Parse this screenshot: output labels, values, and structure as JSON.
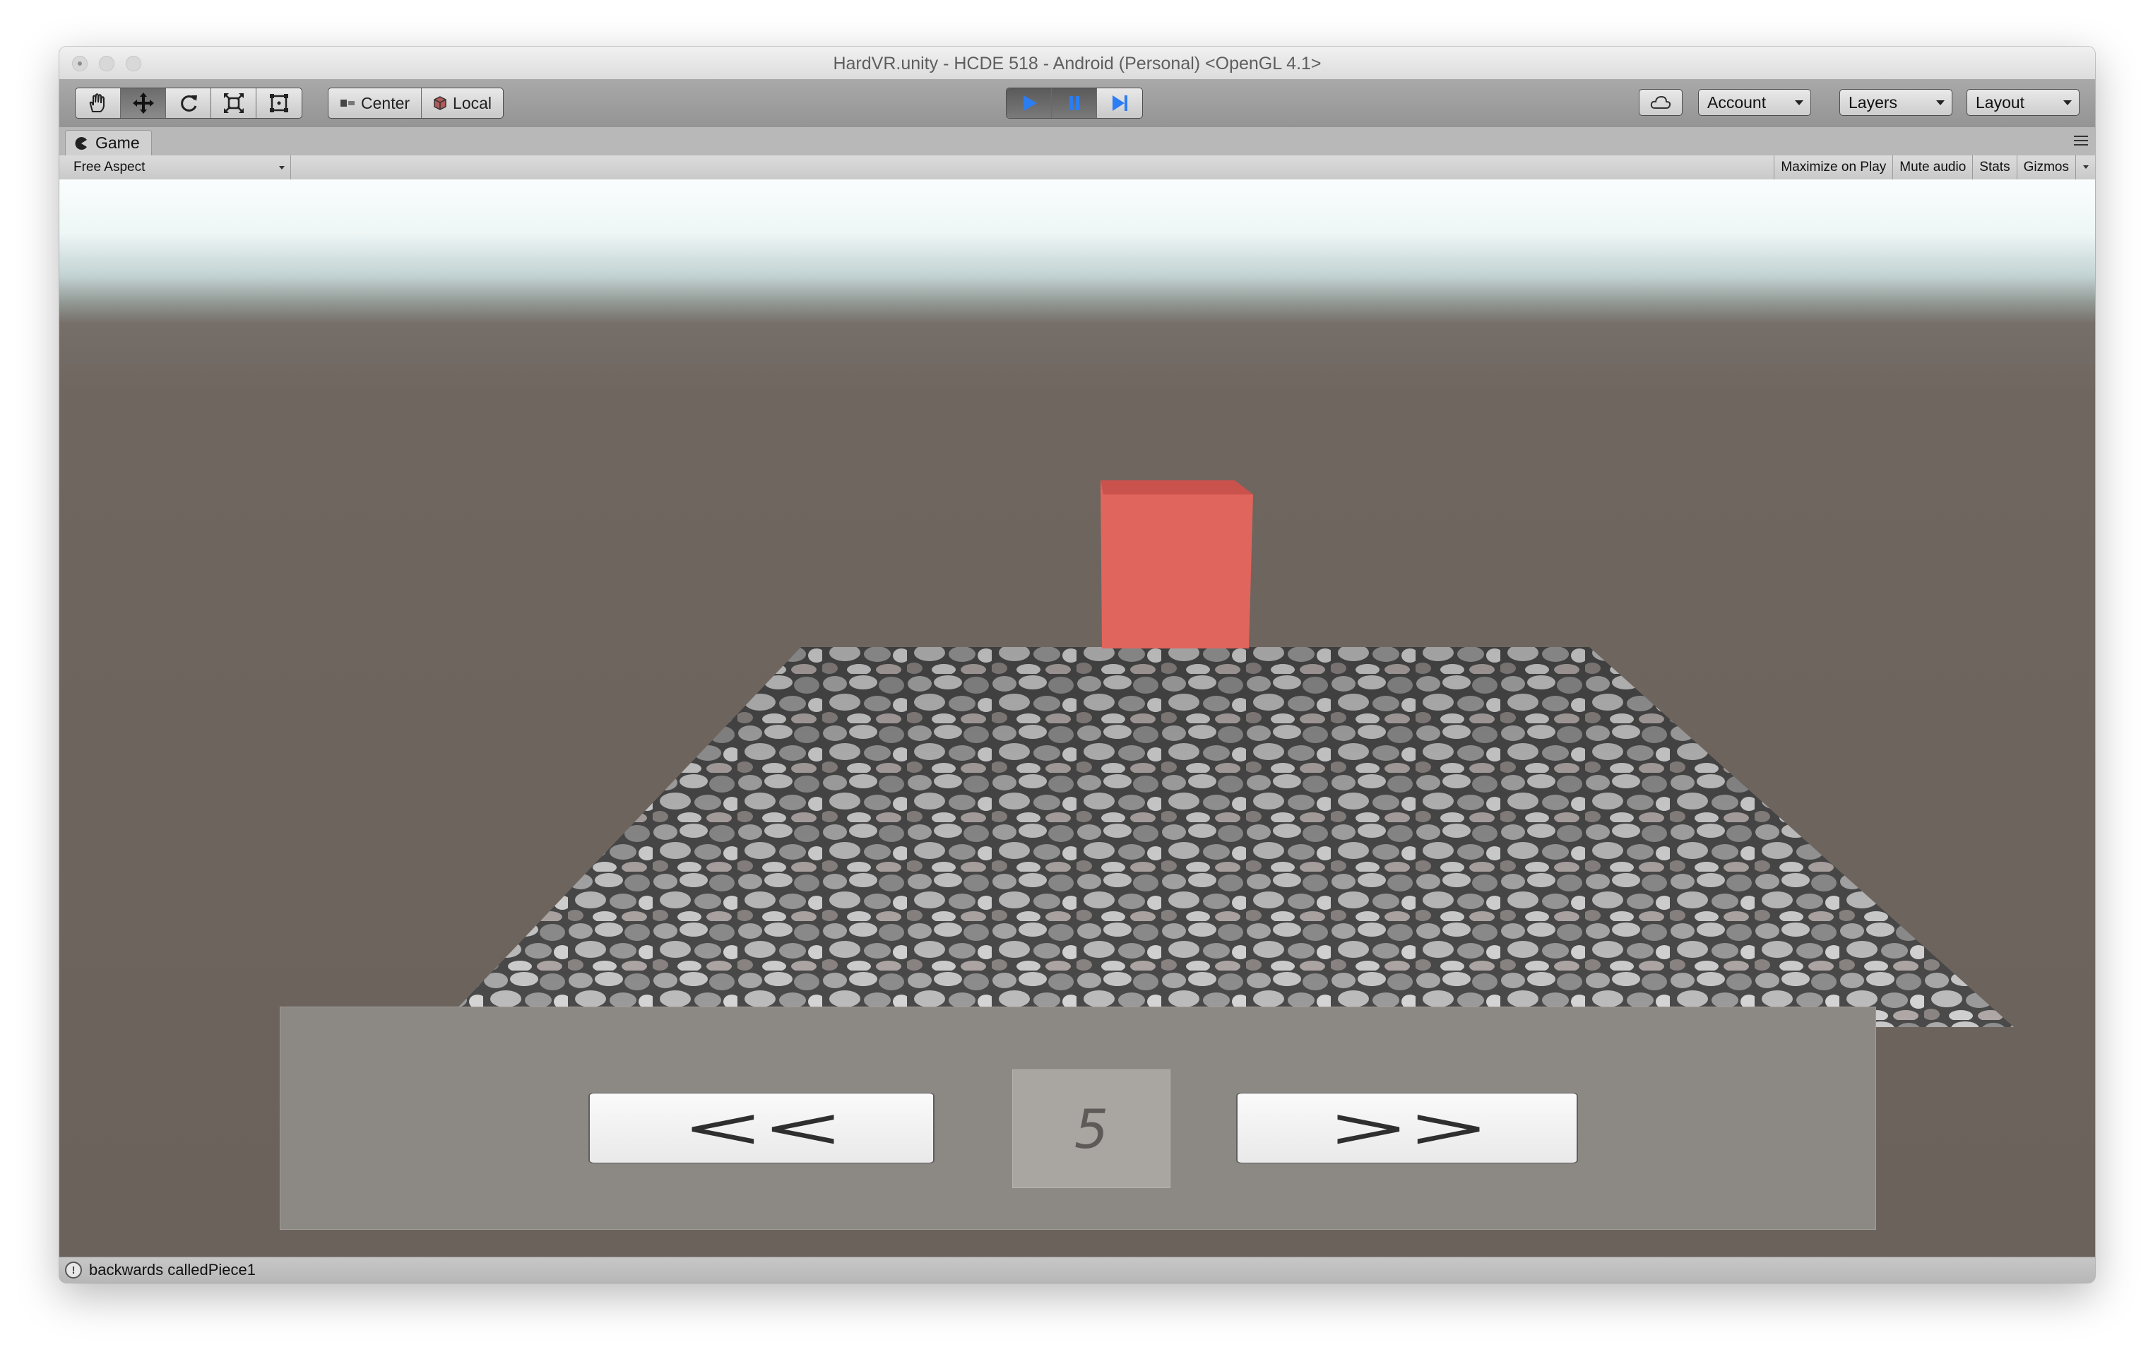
{
  "window": {
    "title": "HardVR.unity - HCDE 518 - Android (Personal) <OpenGL 4.1>"
  },
  "toolbar": {
    "tools": [
      {
        "name": "hand-tool",
        "icon": "hand-icon",
        "active": false
      },
      {
        "name": "move-tool",
        "icon": "move-arrows-icon",
        "active": true
      },
      {
        "name": "rotate-tool",
        "icon": "rotate-icon",
        "active": false
      },
      {
        "name": "scale-tool",
        "icon": "scale-icon",
        "active": false
      },
      {
        "name": "rect-tool",
        "icon": "rect-transform-icon",
        "active": false
      }
    ],
    "pivot_mode_label": "Center",
    "pivot_rotation_label": "Local",
    "play_state": {
      "playing": true,
      "paused": true
    },
    "account_label": "Account",
    "layers_label": "Layers",
    "layout_label": "Layout",
    "accent_color": "#2a7df2"
  },
  "game_view": {
    "tab_label": "Game",
    "aspect_label": "Free Aspect",
    "maximize_label": "Maximize on Play",
    "mute_label": "Mute audio",
    "stats_label": "Stats",
    "gizmos_label": "Gizmos"
  },
  "scene": {
    "cube_color": "#e0655d",
    "prev_label": "<<",
    "next_label": ">>",
    "page_number": "5"
  },
  "status": {
    "message": "backwards calledPiece1"
  }
}
